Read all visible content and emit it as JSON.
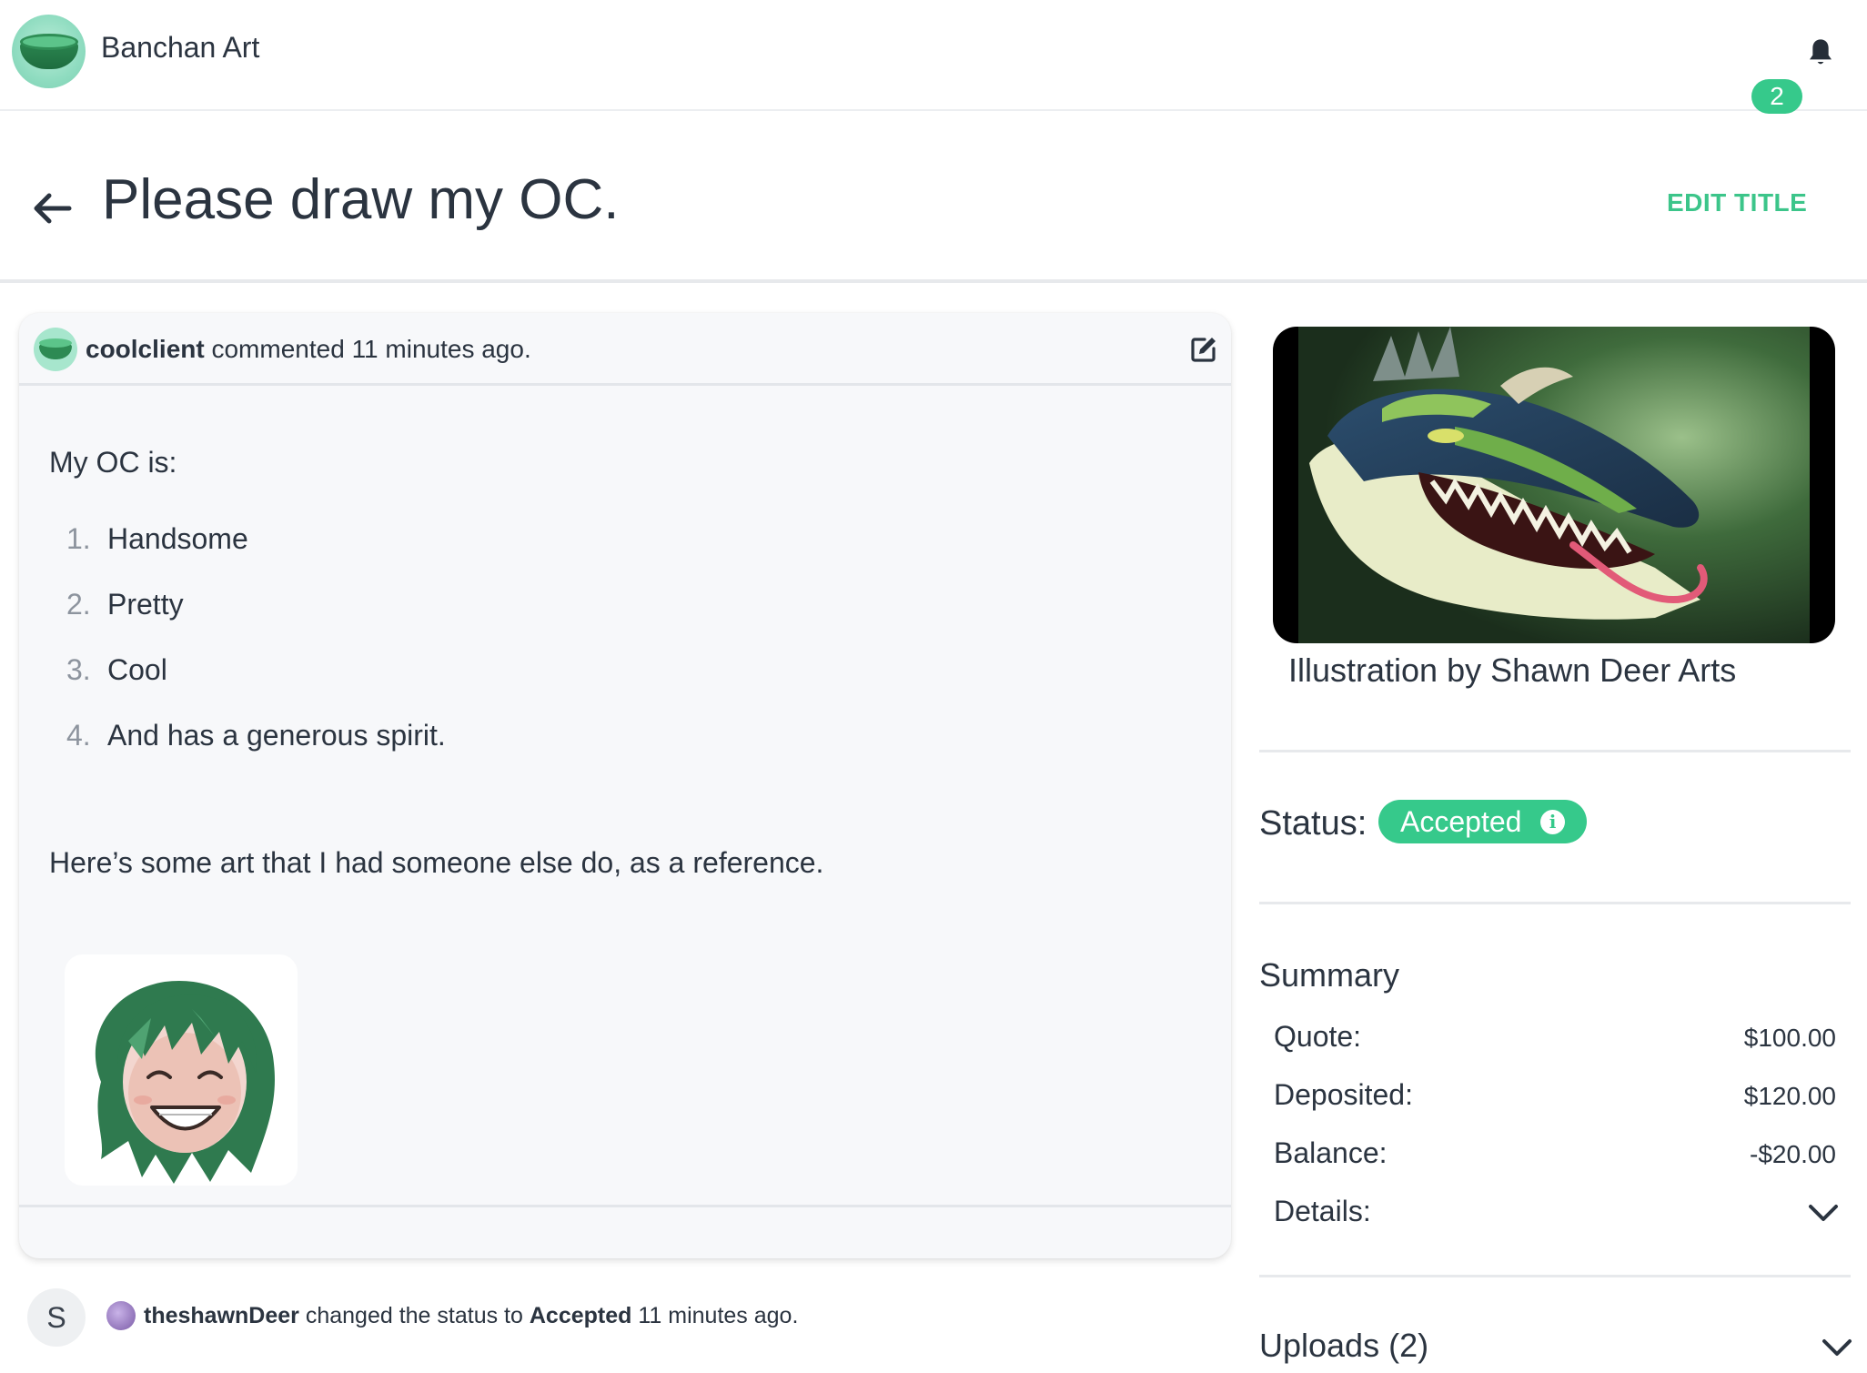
{
  "app": {
    "name": "Banchan Art",
    "notification_count": "2"
  },
  "page": {
    "title": "Please draw my OC.",
    "edit_title_label": "EDIT TITLE"
  },
  "comment": {
    "author": "coolclient",
    "action": "commented",
    "time": "11 minutes ago.",
    "intro": "My OC is:",
    "list": [
      {
        "num": "1.",
        "text": "Handsome"
      },
      {
        "num": "2.",
        "text": "Pretty"
      },
      {
        "num": "3.",
        "text": "Cool"
      },
      {
        "num": "4.",
        "text": "And has a generous spirit."
      }
    ],
    "closing": "Here’s some art that I had someone else do, as a reference."
  },
  "activity": {
    "avatar_letter": "S",
    "user": "theshawnDeer",
    "text": "changed the status to",
    "status": "Accepted",
    "time": "11 minutes ago."
  },
  "sidebar": {
    "caption": "Illustration by Shawn Deer Arts",
    "status_label": "Status:",
    "status_value": "Accepted",
    "summary_title": "Summary",
    "summary_rows": [
      {
        "label": "Quote:",
        "value": "$100.00"
      },
      {
        "label": "Deposited:",
        "value": "$120.00"
      },
      {
        "label": "Balance:",
        "value": "-$20.00"
      }
    ],
    "details_label": "Details:",
    "uploads_label": "Uploads (2)"
  },
  "colors": {
    "accent": "#36c98b",
    "text": "#2b3440",
    "card_bg": "#f7f8fa"
  },
  "icons": [
    "bell-icon",
    "back-arrow-icon",
    "edit-icon",
    "info-icon",
    "chevron-down-icon"
  ]
}
